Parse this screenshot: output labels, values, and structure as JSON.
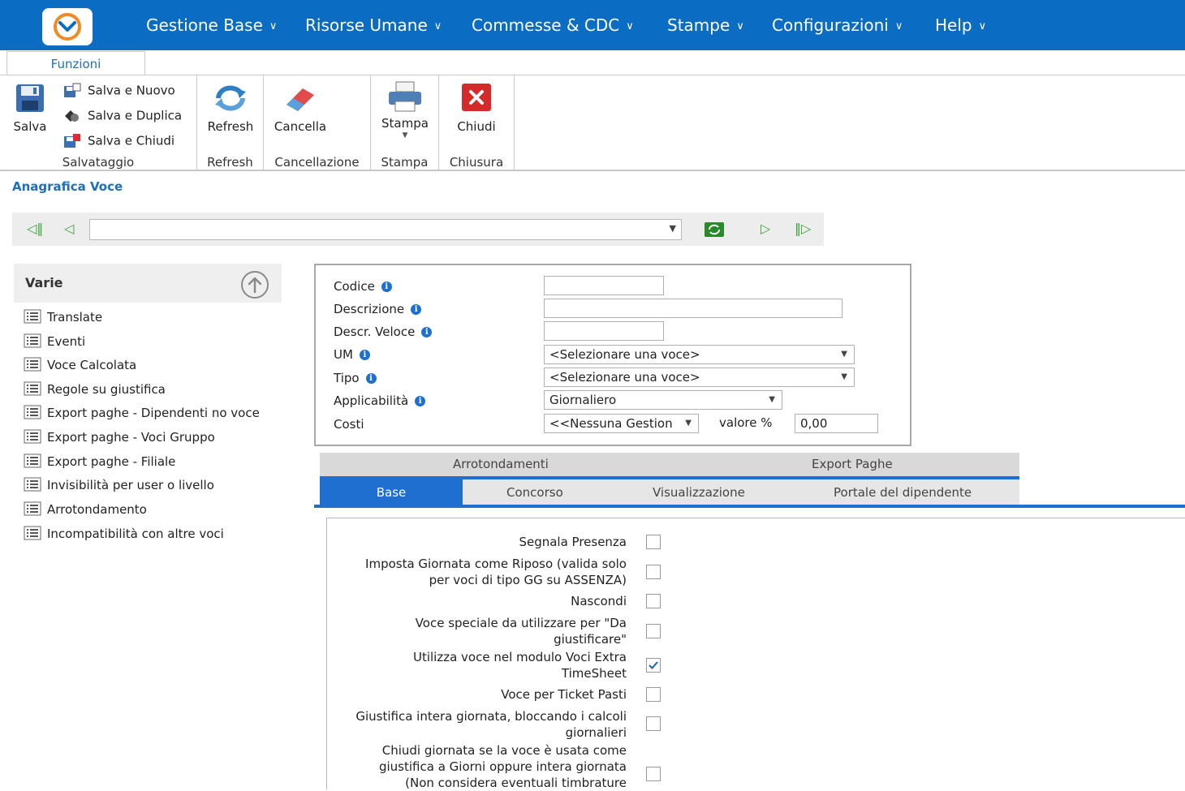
{
  "menu": {
    "items": [
      {
        "label": "Gestione Base"
      },
      {
        "label": "Risorse Umane"
      },
      {
        "label": "Commesse & CDC"
      },
      {
        "label": "Stampe"
      },
      {
        "label": "Configurazioni"
      },
      {
        "label": "Help"
      }
    ],
    "accent_color": "#0a6cc2"
  },
  "ribbon": {
    "tab_label": "Funzioni",
    "salva": "Salva",
    "salva_nuovo": "Salva e Nuovo",
    "salva_duplica": "Salva e Duplica",
    "salva_chiudi": "Salva e Chiudi",
    "group_salvataggio": "Salvataggio",
    "refresh": "Refresh",
    "group_refresh": "Refresh",
    "cancella": "Cancella",
    "group_cancellazione": "Cancellazione",
    "stampa": "Stampa",
    "group_stampa": "Stampa",
    "chiudi": "Chiudi",
    "group_chiusura": "Chiusura"
  },
  "page": {
    "title": "Anagrafica Voce"
  },
  "sidebar": {
    "title": "Varie",
    "items": [
      {
        "label": "Translate"
      },
      {
        "label": "Eventi"
      },
      {
        "label": "Voce Calcolata"
      },
      {
        "label": "Regole su giustifica"
      },
      {
        "label": "Export paghe - Dipendenti no voce"
      },
      {
        "label": "Export paghe - Voci Gruppo"
      },
      {
        "label": "Export paghe - Filiale"
      },
      {
        "label": "Invisibilità per user o livello"
      },
      {
        "label": "Arrotondamento"
      },
      {
        "label": "Incompatibilità con altre voci"
      }
    ]
  },
  "form": {
    "codice_label": "Codice",
    "codice_value": "",
    "descrizione_label": "Descrizione",
    "descrizione_value": "",
    "descr_veloce_label": "Descr. Veloce",
    "descr_veloce_value": "",
    "um_label": "UM",
    "um_value": "<Selezionare una voce>",
    "tipo_label": "Tipo",
    "tipo_value": "<Selezionare una voce>",
    "applicabilita_label": "Applicabilità",
    "applicabilita_value": "Giornaliero",
    "costi_label": "Costi",
    "costi_value": "<<Nessuna Gestion",
    "valore_label": "valore %",
    "valore_value": "0,00"
  },
  "tabs": {
    "row1": [
      {
        "label": "Arrotondamenti"
      },
      {
        "label": "Export Paghe"
      }
    ],
    "row2": [
      {
        "label": "Base",
        "active": true
      },
      {
        "label": "Concorso"
      },
      {
        "label": "Visualizzazione"
      },
      {
        "label": "Portale del dipendente"
      }
    ]
  },
  "options": [
    {
      "line1": "Segnala Presenza",
      "line2": "",
      "line3": "",
      "checked": false
    },
    {
      "line1": "Imposta Giornata come Riposo (valida solo",
      "line2": "per voci di tipo GG su ASSENZA)",
      "line3": "",
      "checked": false
    },
    {
      "line1": "Nascondi",
      "line2": "",
      "line3": "",
      "checked": false
    },
    {
      "line1": "Voce speciale da utilizzare per \"Da",
      "line2": "giustificare\"",
      "line3": "",
      "checked": false
    },
    {
      "line1": "Utilizza voce nel modulo Voci Extra",
      "line2": "TimeSheet",
      "line3": "",
      "checked": true
    },
    {
      "line1": "Voce per Ticket Pasti",
      "line2": "",
      "line3": "",
      "checked": false
    },
    {
      "line1": "Giustifica intera giornata, bloccando i calcoli",
      "line2": "giornalieri",
      "line3": "",
      "checked": false
    },
    {
      "line1": "Chiudi giornata se la voce è usata come",
      "line2": "giustifica a Giorni oppure intera giornata",
      "line3": "(Non considera eventuali timbrature",
      "checked": false
    }
  ]
}
